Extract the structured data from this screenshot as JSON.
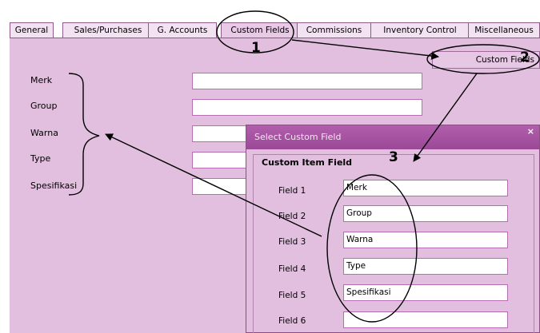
{
  "tabs": [
    "General",
    "Sales/Purchases",
    "G. Accounts",
    "Custom Fields",
    "Commissions",
    "Inventory Control",
    "Miscellaneous"
  ],
  "custom_fields_button": "Custom Fields",
  "left_labels": [
    "Merk",
    "Group",
    "Warna",
    "Type",
    "Spesifikasi"
  ],
  "dialog": {
    "title": "Select Custom Field",
    "close": "×",
    "heading": "Custom Item Field",
    "fields": [
      {
        "label": "Field 1",
        "value": "Merk"
      },
      {
        "label": "Field 2",
        "value": "Group"
      },
      {
        "label": "Field 3",
        "value": "Warna"
      },
      {
        "label": "Field 4",
        "value": "Type"
      },
      {
        "label": "Field 5",
        "value": "Spesifikasi"
      },
      {
        "label": "Field 6",
        "value": ""
      }
    ]
  },
  "annotations": {
    "n1": "1",
    "n2": "2",
    "n3": "3"
  }
}
